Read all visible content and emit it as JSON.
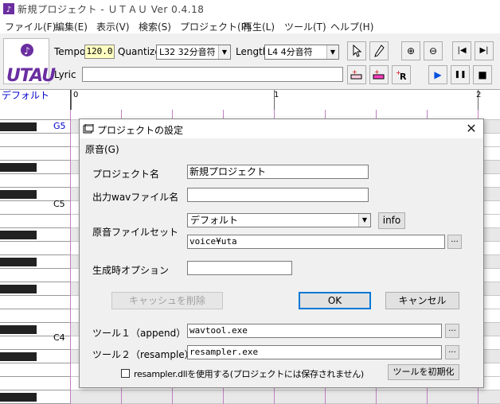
{
  "window": {
    "title": "新規プロジェクト - ＵＴＡＵ Ver 0.4.18"
  },
  "menu": [
    "ファイル(F)",
    "編集(E)",
    "表示(V)",
    "検索(S)",
    "プロジェクト(P)",
    "再生(L)",
    "ツール(T)",
    "ヘルプ(H)"
  ],
  "toolbar": {
    "logo_text": "UTAU",
    "tempo_label": "Tempo",
    "tempo_value": "120.0",
    "quantize_label": "Quantize",
    "quantize_value": "L32 32分音符",
    "length_label": "Length",
    "length_value": "L4  4分音符",
    "lyric_label": "Lyric",
    "lyric_value": "",
    "button_glyphs": {
      "zoom_in": "⊕",
      "zoom_out": "⊖",
      "go_start": "|◀",
      "go_end": "▶|",
      "play": "▶",
      "pause": "❚❚",
      "stop": "■"
    }
  },
  "track": {
    "name": "デフォルト",
    "measures": [
      "0",
      "1",
      "2"
    ]
  },
  "piano": {
    "labels": [
      "G5",
      "C5",
      "C4"
    ]
  },
  "dialog": {
    "title": "プロジェクトの設定",
    "menu_label": "原音(G)",
    "project_name_label": "プロジェクト名",
    "project_name_value": "新規プロジェクト",
    "output_wav_label": "出力wavファイル名",
    "output_wav_value": "",
    "voicebank_label": "原音ファイルセット",
    "voicebank_value": "デフォルト",
    "info_button": "info",
    "voice_path_value": "voice¥uta",
    "browse_label": "...",
    "options_label": "生成時オプション",
    "options_value": "",
    "clear_cache_button": "キャッシュを削除",
    "ok_button": "OK",
    "cancel_button": "キャンセル",
    "tool1_label": "ツール１（append）",
    "tool1_value": "wavtool.exe",
    "tool2_label": "ツール２（resample）",
    "tool2_value": "resampler.exe",
    "resampler_dll_label": "resampler.dllを使用する(プロジェクトには保存されません)",
    "resampler_dll_checked": false,
    "reset_tools_button": "ツールを初期化"
  },
  "colors": {
    "accent": "#0078d7",
    "logo": "#6a2ea0",
    "track_name": "#0000cc",
    "grid_line": "#c080c0",
    "tempo_bg": "#ffffc0"
  }
}
